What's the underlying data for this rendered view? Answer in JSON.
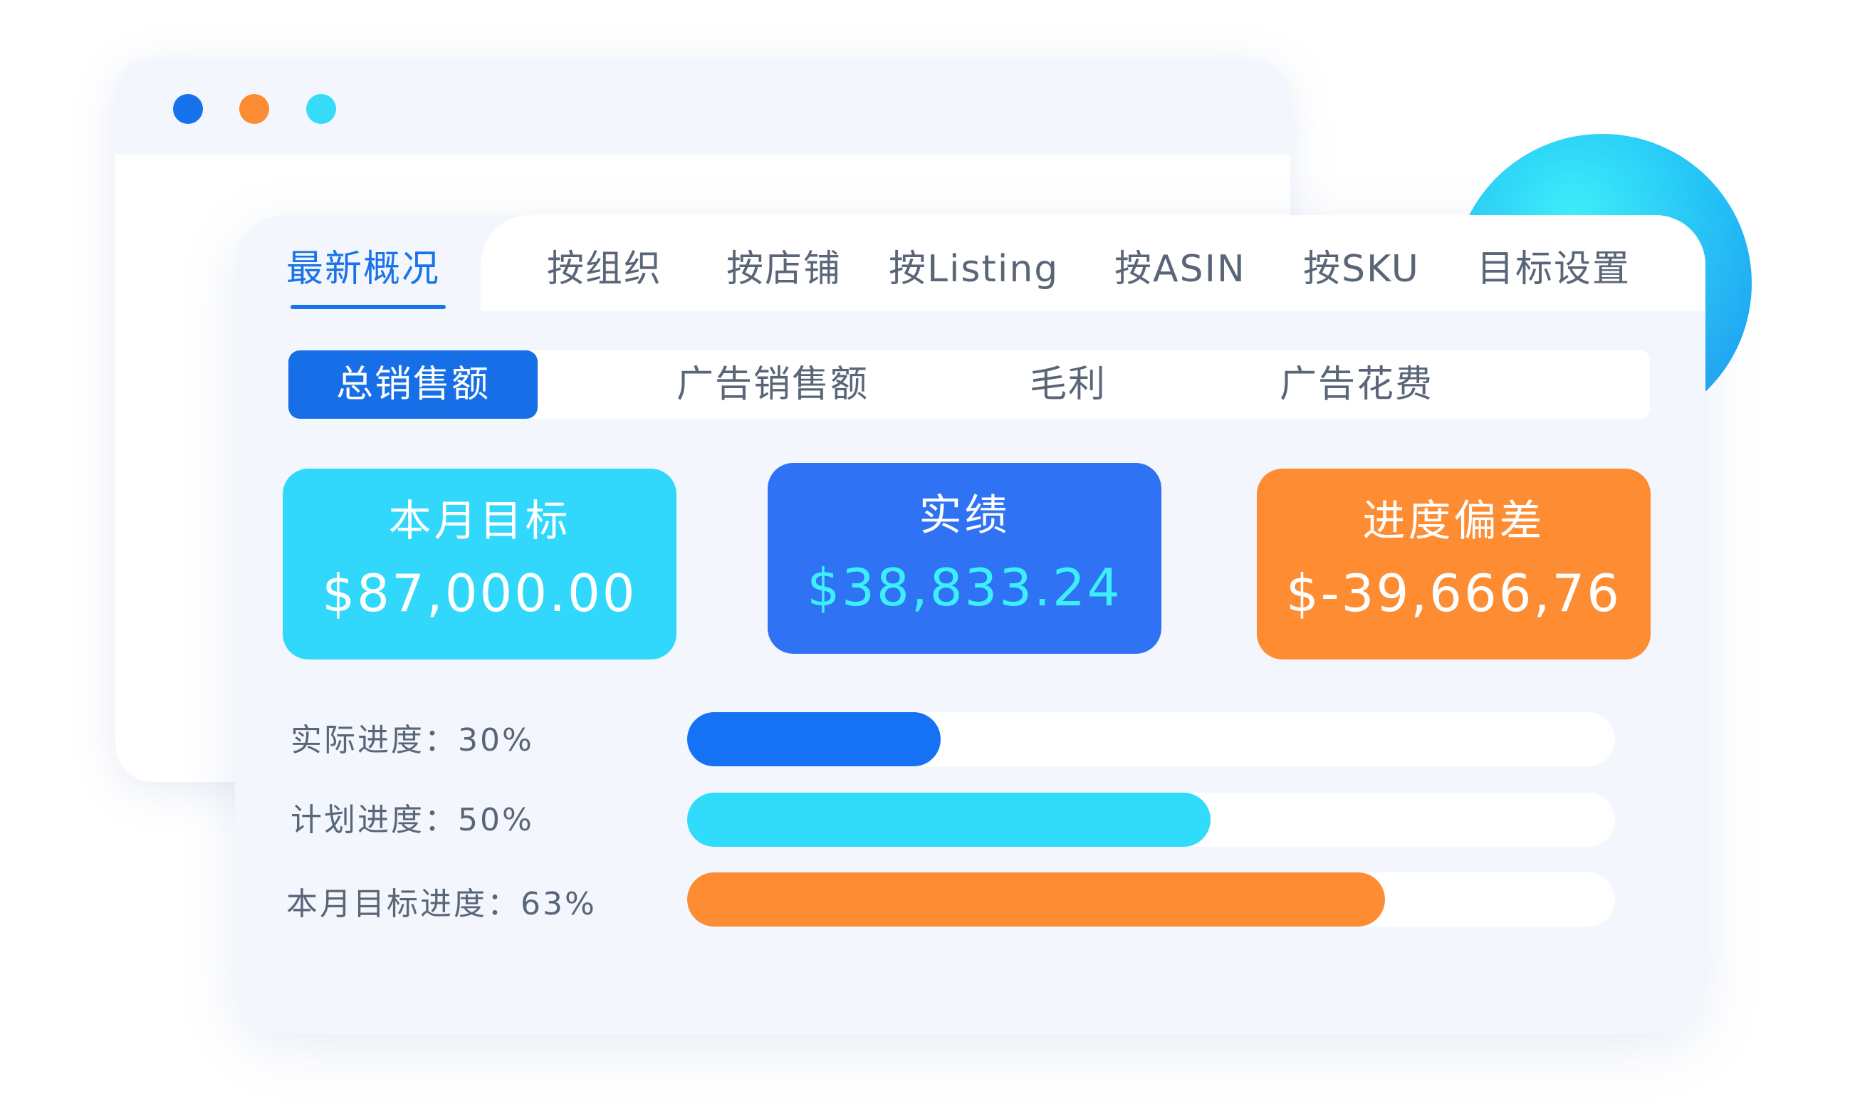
{
  "window": {
    "dots": [
      {
        "name": "blue",
        "color": "#1572ea"
      },
      {
        "name": "orange",
        "color": "#fb8c33"
      },
      {
        "name": "cyan",
        "color": "#34dcf7"
      }
    ]
  },
  "tabs": [
    {
      "label": "最新概况",
      "active": true
    },
    {
      "label": "按组织",
      "active": false
    },
    {
      "label": "按店铺",
      "active": false
    },
    {
      "label": "按Listing",
      "active": false
    },
    {
      "label": "按ASIN",
      "active": false
    },
    {
      "label": "按SKU",
      "active": false
    },
    {
      "label": "目标设置",
      "active": false
    }
  ],
  "metric_tabs": [
    {
      "label": "总销售额",
      "active": true
    },
    {
      "label": "广告销售额",
      "active": false
    },
    {
      "label": "毛利",
      "active": false
    },
    {
      "label": "广告花费",
      "active": false
    }
  ],
  "cards": [
    {
      "label": "本月目标",
      "value": "$87,000.00",
      "bg": "#31d8fb",
      "value_color": "#ffffff"
    },
    {
      "label": "实绩",
      "value": "$38,833.24",
      "bg": "#2f73f4",
      "value_color": "#3bf0fb"
    },
    {
      "label": "进度偏差",
      "value": "$-39,666,76",
      "bg": "#fd8c33",
      "value_color": "#ffffff"
    }
  ],
  "progress": [
    {
      "label": "实际进度：30%",
      "fraction": 0.273,
      "color": "#1572f5"
    },
    {
      "label": "计划进度：50%",
      "fraction": 0.564,
      "color": "#31dcfb"
    },
    {
      "label": "本月目标进度：63%",
      "fraction": 0.752,
      "color": "#fd8c33"
    }
  ]
}
